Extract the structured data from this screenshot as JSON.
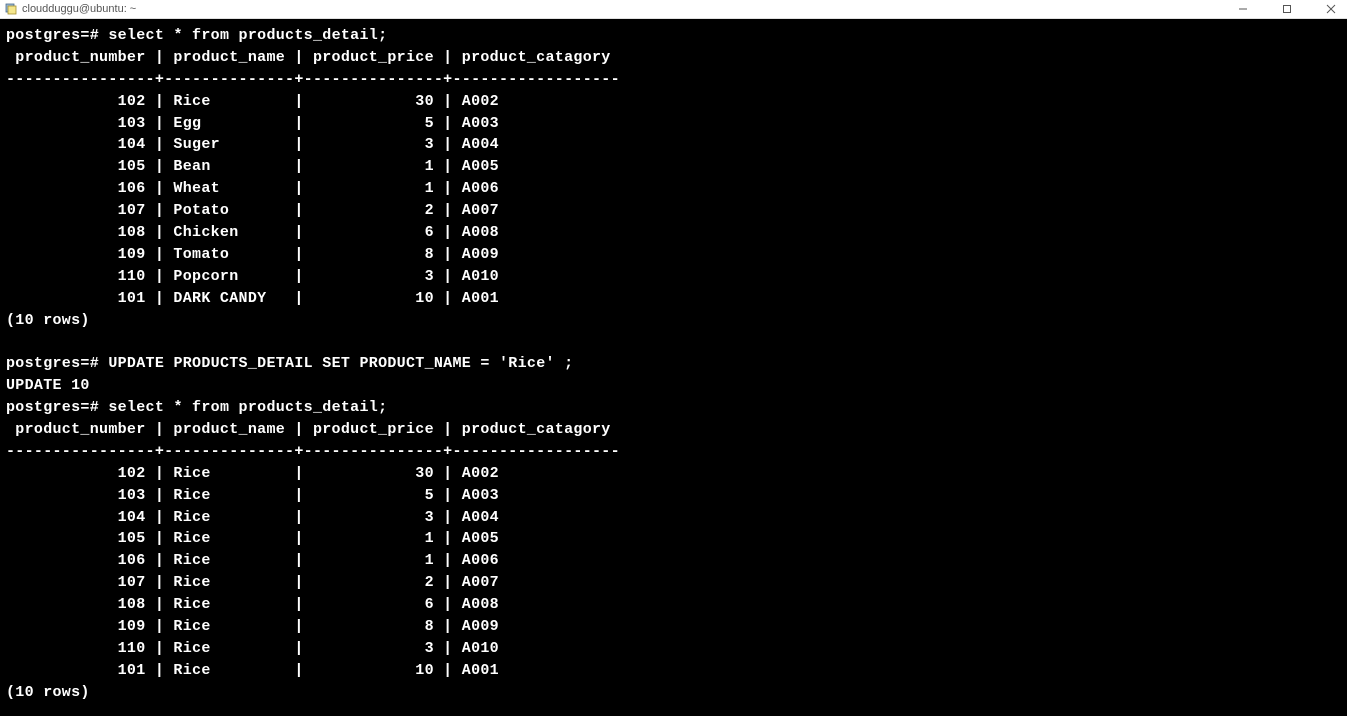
{
  "window": {
    "title": "cloudduggu@ubuntu: ~"
  },
  "terminal": {
    "prompt": "postgres=#",
    "query1": "select * from products_detail;",
    "header_line": " product_number | product_name | product_price | product_catagory",
    "divider_line": "----------------+--------------+---------------+------------------",
    "rows1": [
      {
        "num": "102",
        "name": "Rice",
        "price": "30",
        "cat": "A002"
      },
      {
        "num": "103",
        "name": "Egg",
        "price": "5",
        "cat": "A003"
      },
      {
        "num": "104",
        "name": "Suger",
        "price": "3",
        "cat": "A004"
      },
      {
        "num": "105",
        "name": "Bean",
        "price": "1",
        "cat": "A005"
      },
      {
        "num": "106",
        "name": "Wheat",
        "price": "1",
        "cat": "A006"
      },
      {
        "num": "107",
        "name": "Potato",
        "price": "2",
        "cat": "A007"
      },
      {
        "num": "108",
        "name": "Chicken",
        "price": "6",
        "cat": "A008"
      },
      {
        "num": "109",
        "name": "Tomato",
        "price": "8",
        "cat": "A009"
      },
      {
        "num": "110",
        "name": "Popcorn",
        "price": "3",
        "cat": "A010"
      },
      {
        "num": "101",
        "name": "DARK CANDY",
        "price": "10",
        "cat": "A001"
      }
    ],
    "rowcount1": "(10 rows)",
    "query2": "UPDATE PRODUCTS_DETAIL SET PRODUCT_NAME = 'Rice' ;",
    "update_result": "UPDATE 10",
    "query3": "select * from products_detail;",
    "rows2": [
      {
        "num": "102",
        "name": "Rice",
        "price": "30",
        "cat": "A002"
      },
      {
        "num": "103",
        "name": "Rice",
        "price": "5",
        "cat": "A003"
      },
      {
        "num": "104",
        "name": "Rice",
        "price": "3",
        "cat": "A004"
      },
      {
        "num": "105",
        "name": "Rice",
        "price": "1",
        "cat": "A005"
      },
      {
        "num": "106",
        "name": "Rice",
        "price": "1",
        "cat": "A006"
      },
      {
        "num": "107",
        "name": "Rice",
        "price": "2",
        "cat": "A007"
      },
      {
        "num": "108",
        "name": "Rice",
        "price": "6",
        "cat": "A008"
      },
      {
        "num": "109",
        "name": "Rice",
        "price": "8",
        "cat": "A009"
      },
      {
        "num": "110",
        "name": "Rice",
        "price": "3",
        "cat": "A010"
      },
      {
        "num": "101",
        "name": "Rice",
        "price": "10",
        "cat": "A001"
      }
    ],
    "rowcount2": "(10 rows)"
  }
}
